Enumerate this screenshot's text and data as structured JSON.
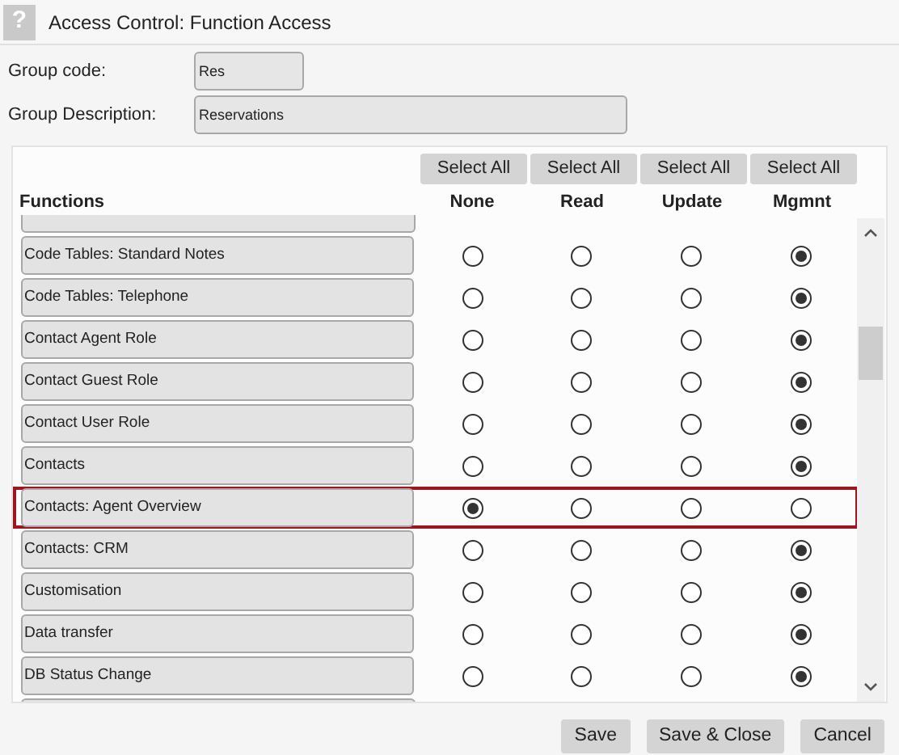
{
  "window": {
    "title": "Access Control: Function Access",
    "help_icon": "?"
  },
  "fields": [
    {
      "label": "Group code:",
      "value": "Res",
      "kind": "short"
    },
    {
      "label": "Group Description:",
      "value": "Reservations",
      "kind": "long"
    }
  ],
  "columns": [
    {
      "button": "Select All",
      "label": "None"
    },
    {
      "button": "Select All",
      "label": "Read"
    },
    {
      "button": "Select All",
      "label": "Update"
    },
    {
      "button": "Select All",
      "label": "Mgmnt"
    }
  ],
  "functions_heading": "Functions",
  "rows": [
    {
      "label": "Code Tables: Standard Notes",
      "highlighted": false,
      "options": [
        {
          "selected": false
        },
        {
          "selected": false
        },
        {
          "selected": false
        },
        {
          "selected": true
        }
      ]
    },
    {
      "label": "Code Tables: Telephone",
      "highlighted": false,
      "options": [
        {
          "selected": false
        },
        {
          "selected": false
        },
        {
          "selected": false
        },
        {
          "selected": true
        }
      ]
    },
    {
      "label": "Contact Agent Role",
      "highlighted": false,
      "options": [
        {
          "selected": false
        },
        {
          "selected": false
        },
        {
          "selected": false
        },
        {
          "selected": true
        }
      ]
    },
    {
      "label": "Contact Guest Role",
      "highlighted": false,
      "options": [
        {
          "selected": false
        },
        {
          "selected": false
        },
        {
          "selected": false
        },
        {
          "selected": true
        }
      ]
    },
    {
      "label": "Contact User Role",
      "highlighted": false,
      "options": [
        {
          "selected": false
        },
        {
          "selected": false
        },
        {
          "selected": false
        },
        {
          "selected": true
        }
      ]
    },
    {
      "label": "Contacts",
      "highlighted": false,
      "options": [
        {
          "selected": false
        },
        {
          "selected": false
        },
        {
          "selected": false
        },
        {
          "selected": true
        }
      ]
    },
    {
      "label": "Contacts: Agent Overview",
      "highlighted": true,
      "options": [
        {
          "selected": true
        },
        {
          "selected": false
        },
        {
          "selected": false
        },
        {
          "selected": false
        }
      ]
    },
    {
      "label": "Contacts: CRM",
      "highlighted": false,
      "options": [
        {
          "selected": false
        },
        {
          "selected": false
        },
        {
          "selected": false
        },
        {
          "selected": true
        }
      ]
    },
    {
      "label": "Customisation",
      "highlighted": false,
      "options": [
        {
          "selected": false
        },
        {
          "selected": false
        },
        {
          "selected": false
        },
        {
          "selected": true
        }
      ]
    },
    {
      "label": "Data transfer",
      "highlighted": false,
      "options": [
        {
          "selected": false
        },
        {
          "selected": false
        },
        {
          "selected": false
        },
        {
          "selected": true
        }
      ]
    },
    {
      "label": "DB Status Change",
      "highlighted": false,
      "options": [
        {
          "selected": false
        },
        {
          "selected": false
        },
        {
          "selected": false
        },
        {
          "selected": true
        }
      ]
    }
  ],
  "buttons": [
    "Save",
    "Save & Close",
    "Cancel"
  ]
}
